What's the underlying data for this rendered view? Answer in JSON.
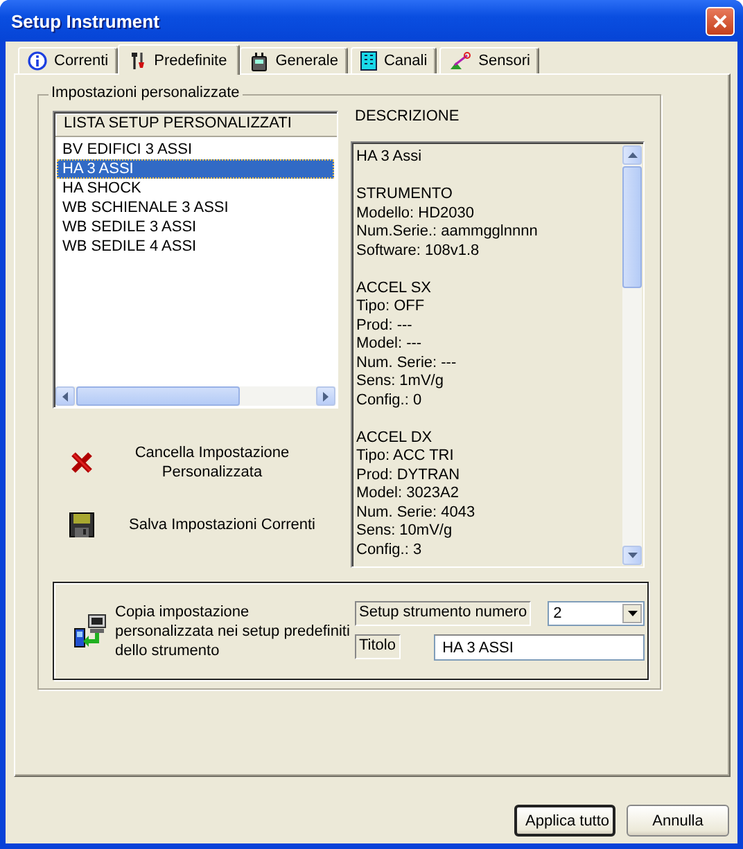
{
  "window": {
    "title": "Setup Instrument"
  },
  "tabs": [
    {
      "label": "Correnti",
      "kind": "info",
      "selected": false
    },
    {
      "label": "Predefinite",
      "kind": "tools",
      "selected": true
    },
    {
      "label": "Generale",
      "kind": "device",
      "selected": false
    },
    {
      "label": "Canali",
      "kind": "channels",
      "selected": false
    },
    {
      "label": "Sensori",
      "kind": "sensor",
      "selected": false
    }
  ],
  "custom_settings": {
    "title": "Impostazioni personalizzate",
    "list": {
      "header": "LISTA SETUP PERSONALIZZATI",
      "items": [
        {
          "label": "BV EDIFICI 3 ASSI",
          "selected": false
        },
        {
          "label": "HA 3 ASSI",
          "selected": true
        },
        {
          "label": "HA SHOCK",
          "selected": false
        },
        {
          "label": "WB SCHIENALE 3 ASSI",
          "selected": false
        },
        {
          "label": "WB SEDILE 3 ASSI",
          "selected": false
        },
        {
          "label": "WB SEDILE 4 ASSI",
          "selected": false
        }
      ]
    },
    "description": {
      "label": "DESCRIZIONE",
      "blocks": [
        [
          "HA 3 Assi"
        ],
        [
          "STRUMENTO",
          "Modello: HD2030",
          "Num.Serie.: aammgglnnnn",
          "Software: 108v1.8"
        ],
        [
          "ACCEL SX",
          "Tipo: OFF",
          "Prod: ---",
          "Model: ---",
          "Num. Serie: ---",
          "Sens: 1mV/g",
          "Config.: 0"
        ],
        [
          "ACCEL DX",
          "Tipo: ACC TRI",
          "Prod: DYTRAN",
          "Model: 3023A2",
          "Num. Serie: 4043",
          "Sens: 10mV/g",
          "Config.: 3"
        ]
      ]
    },
    "actions": [
      {
        "kind": "delete",
        "label": "Cancella Impostazione Personalizzata"
      },
      {
        "kind": "save",
        "label": "Salva Impostazioni Correnti"
      }
    ],
    "copy": {
      "text": "Copia impostazione personalizzata nei setup predefiniti dello strumento",
      "number_label": "Setup strumento numero",
      "number_value": "2",
      "title_label": "Titolo",
      "title_value": "HA 3 ASSI"
    }
  },
  "buttons": [
    {
      "label": "Applica tutto",
      "default": true
    },
    {
      "label": "Annulla",
      "default": false
    }
  ]
}
